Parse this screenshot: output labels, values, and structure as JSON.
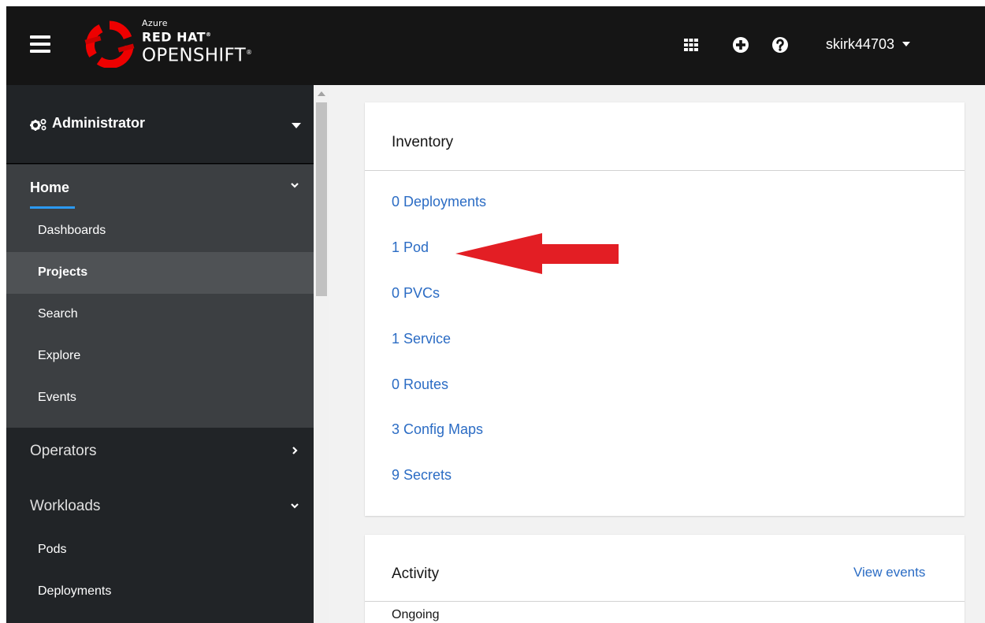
{
  "masthead": {
    "brand": {
      "line1": "Azure",
      "line2": "RED HAT",
      "line2_mark": "®",
      "line3": "OPENSHIFT",
      "line3_mark": "®"
    },
    "toolbar": {
      "app_launcher_icon": "grid-icon",
      "add_icon": "plus-circle-icon",
      "help_icon": "question-circle-icon"
    },
    "user": {
      "name": "skirk44703"
    }
  },
  "sidebar": {
    "perspective": {
      "label": "Administrator",
      "icon": "cogs-icon"
    },
    "home": {
      "label": "Home",
      "items": [
        "Dashboards",
        "Projects",
        "Search",
        "Explore",
        "Events"
      ],
      "active": "Projects"
    },
    "operators": {
      "label": "Operators"
    },
    "workloads": {
      "label": "Workloads",
      "items": [
        "Pods",
        "Deployments"
      ]
    }
  },
  "inventory": {
    "title": "Inventory",
    "links": [
      "0 Deployments",
      "1 Pod",
      "0 PVCs",
      "1 Service",
      "0 Routes",
      "3 Config Maps",
      "9 Secrets"
    ]
  },
  "activity": {
    "title": "Activity",
    "view_events": "View events",
    "ongoing": "Ongoing"
  },
  "colors": {
    "masthead_bg": "#151515",
    "sidebar_bg": "#212427",
    "sidebar_section_bg": "#3c3f42",
    "sidebar_active_bg": "#4f5255",
    "accent_underline": "#2b9af3",
    "link": "#2b6cc4",
    "annotation_arrow": "#e31e24",
    "page_bg": "#f2f2f2"
  }
}
